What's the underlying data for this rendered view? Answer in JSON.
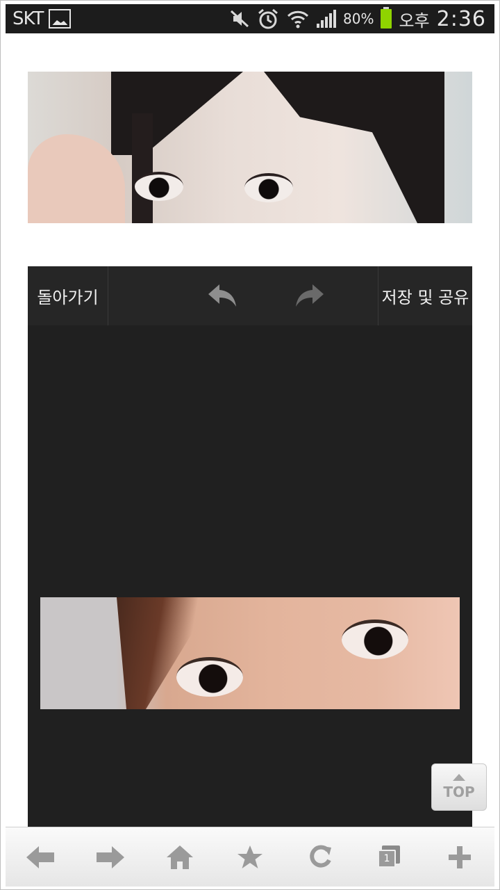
{
  "status_bar": {
    "carrier": "SKT",
    "battery_percent": "80%",
    "ampm": "오후",
    "time": "2:36",
    "icons": [
      "gallery-icon",
      "mute-icon",
      "alarm-icon",
      "wifi-icon",
      "signal-icon",
      "battery-icon"
    ],
    "battery_color": "#8fd400"
  },
  "editor": {
    "back_label": "돌아가기",
    "save_share_label": "저장 및 공유",
    "undo_icon": "undo-icon",
    "redo_icon": "redo-icon",
    "background": "#202020"
  },
  "top_button": {
    "label": "TOP"
  },
  "browser_bar": {
    "items": [
      "back-arrow-icon",
      "forward-arrow-icon",
      "home-icon",
      "bookmark-star-icon",
      "refresh-icon",
      "tabs-icon",
      "new-tab-plus-icon"
    ],
    "tab_count": "1"
  }
}
